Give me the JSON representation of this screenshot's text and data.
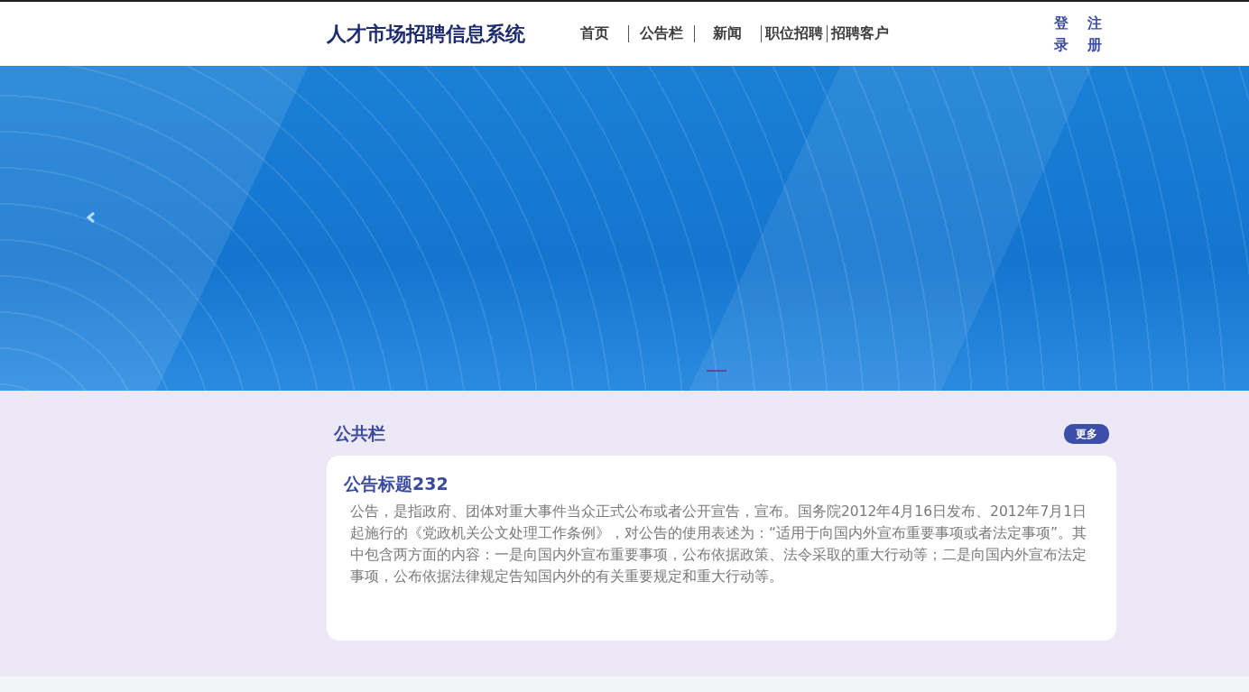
{
  "header": {
    "logo": "人才市场招聘信息系统",
    "nav": [
      {
        "label": "首页"
      },
      {
        "label": "公告栏"
      },
      {
        "label": "新闻"
      },
      {
        "label": "职位招聘"
      },
      {
        "label": "招聘客户"
      }
    ],
    "login": "登录",
    "register": "注册"
  },
  "banner": {
    "indicators": [
      {
        "selected": true
      }
    ]
  },
  "notice_section": {
    "title": "公共栏",
    "more_button": "更多",
    "notice": {
      "title": "公告标题232",
      "body": "公告，是指政府、团体对重大事件当众正式公布或者公开宣告，宣布。国务院2012年4月16日发布、2012年7月1日起施行的《党政机关公文处理工作条例》，对公告的使用表述为：“适用于向国内外宣布重要事项或者法定事项”。其中包含两方面的内容：一是向国内外宣布重要事项，公布依据政策、法令采取的重大行动等；二是向国内外宣布法定事项，公布依据法律规定告知国内外的有关重要规定和重大行动等。"
    }
  }
}
